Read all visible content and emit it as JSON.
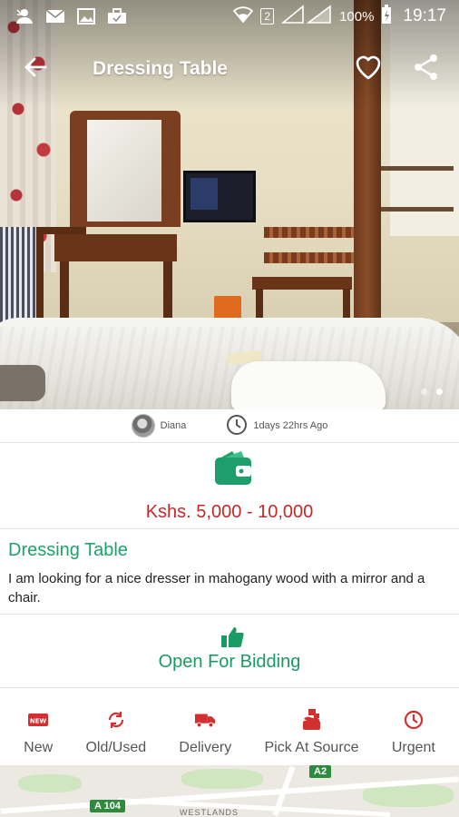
{
  "status_bar": {
    "signal_sim": "2",
    "battery": "100%",
    "time": "19:17",
    "icons": [
      "missed-call-icon",
      "email-icon",
      "image-icon",
      "briefcase-icon",
      "wifi-icon",
      "signal-icon",
      "battery-icon"
    ]
  },
  "app_bar": {
    "title": "Dressing Table",
    "icons": [
      "back-arrow-icon",
      "heart-icon",
      "share-icon"
    ]
  },
  "gallery": {
    "page_count": 2,
    "active_page": 2
  },
  "meta": {
    "user_name": "Diana",
    "posted_ago": "1days 22hrs  Ago"
  },
  "budget": {
    "icon": "wallet-icon",
    "price": "Kshs. 5,000 - 10,000"
  },
  "request": {
    "title": "Dressing Table",
    "description": "I am looking for a nice dresser in mahogany wood with a mirror and a chair."
  },
  "bidding": {
    "icon": "thumbs-up-icon",
    "label": "Open For Bidding"
  },
  "features": [
    {
      "label": "New",
      "icon": "new-badge-icon"
    },
    {
      "label": "Old/Used",
      "icon": "refresh-icon"
    },
    {
      "label": "Delivery",
      "icon": "truck-icon"
    },
    {
      "label": "Pick At Source",
      "icon": "pickup-icon"
    },
    {
      "label": "Urgent",
      "icon": "clock-icon"
    }
  ],
  "map": {
    "road_a104": "A 104",
    "road_a2": "A2",
    "area": "WESTLANDS"
  },
  "colors": {
    "price_red": "#c62828",
    "accent_green": "#1aa36b",
    "feature_red": "#d32f2f"
  }
}
